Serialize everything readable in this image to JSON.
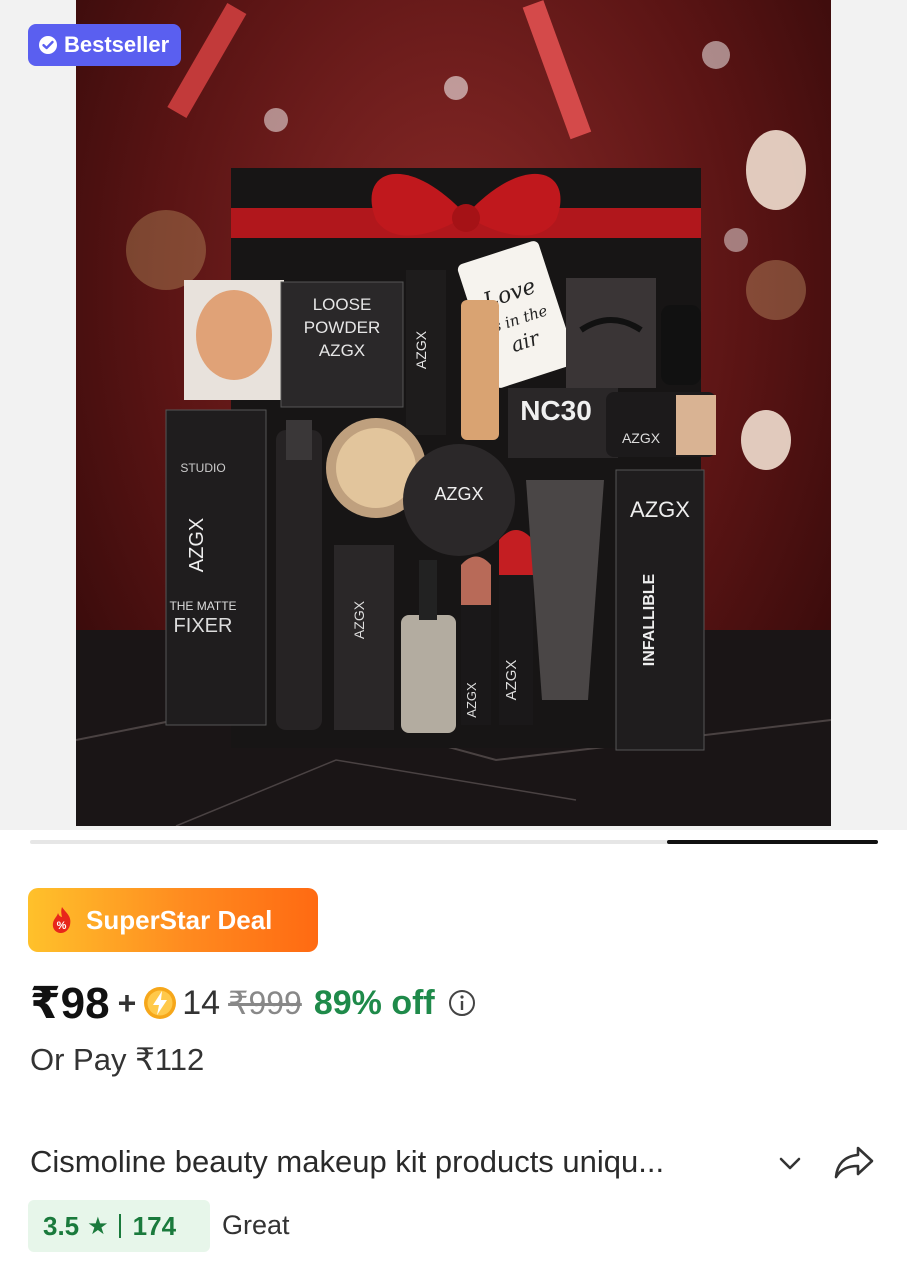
{
  "badge": {
    "label": "Bestseller",
    "color": "#5a5ff0",
    "icon": "verified-check-icon"
  },
  "image": {
    "box_labels": [
      "LOOSE",
      "POWDER",
      "AZGX",
      "AZGX",
      "AZGX",
      "AZGX",
      "AZGX",
      "NC30",
      "AZGX",
      "INFALLIBLE",
      "THE MATTE",
      "FIXER",
      "STUDIO"
    ],
    "tag_lines": [
      "Love",
      "is in the",
      "air"
    ]
  },
  "gallery": {
    "progress": 0.25
  },
  "deal": {
    "label": "SuperStar Deal",
    "icon": "fire-percent-icon"
  },
  "price": {
    "current": "₹98",
    "plus": "+",
    "coins": "14",
    "coin_icon": "lightning-coin-icon",
    "mrp": "₹999",
    "discount": "89% off",
    "discount_color": "#1f8a4a"
  },
  "alt_price": "Or Pay ₹112",
  "product": {
    "title": "Cismoline beauty makeup kit products uniqu...",
    "rating": "3.5",
    "star": "★",
    "reviews": "174",
    "rating_word": "Great"
  }
}
